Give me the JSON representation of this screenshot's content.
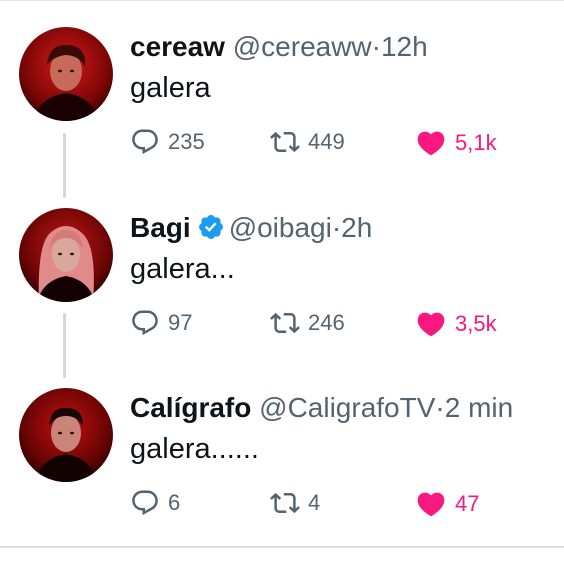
{
  "tweets": [
    {
      "name": "cereaw",
      "handle": "@cereaww",
      "separator": "·",
      "time": "12h",
      "verified": false,
      "text": "galera",
      "replies": "235",
      "retweets": "449",
      "likes": "5,1k"
    },
    {
      "name": "Bagi",
      "handle": "@oibagi",
      "separator": "·",
      "time": "2h",
      "verified": true,
      "text": "galera...",
      "replies": "97",
      "retweets": "246",
      "likes": "3,5k"
    },
    {
      "name": "Calígrafo",
      "handle": "@CaligrafoTV",
      "separator": "·",
      "time": "2 min",
      "verified": false,
      "text": "galera......",
      "replies": "6",
      "retweets": "4",
      "likes": "47"
    }
  ],
  "icons": {
    "reply": "speech-bubble-icon",
    "retweet": "retweet-arrows-icon",
    "like": "heart-filled-icon",
    "verified": "verified-badge-icon"
  },
  "colors": {
    "like": "#f91880",
    "verified": "#1d9bf0",
    "muted": "#536471",
    "thread_line": "#cfd9de"
  }
}
